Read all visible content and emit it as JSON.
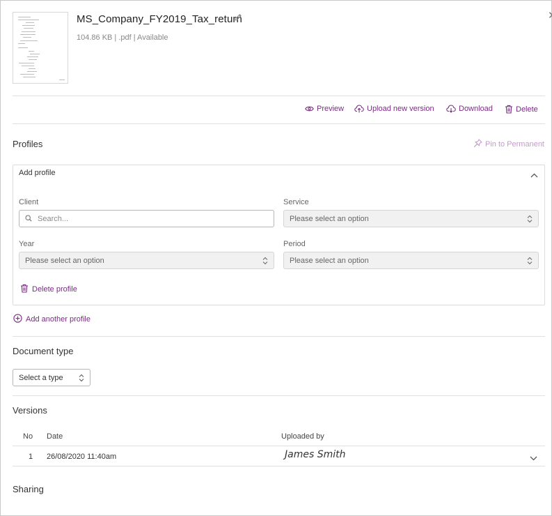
{
  "file": {
    "name": "MS_Company_FY2019_Tax_return",
    "size": "104.86 KB",
    "extension": ".pdf",
    "status": "Available",
    "meta_line": "104.86 KB | .pdf | Available"
  },
  "actions": {
    "preview": "Preview",
    "upload_new_version": "Upload new version",
    "download": "Download",
    "delete": "Delete"
  },
  "profiles": {
    "title": "Profiles",
    "pin_label": "Pin to Permanent",
    "card": {
      "title": "Add profile",
      "client_label": "Client",
      "client_placeholder": "Search...",
      "service_label": "Service",
      "service_value": "Please select an option",
      "year_label": "Year",
      "year_value": "Please select an option",
      "period_label": "Period",
      "period_value": "Please select an option",
      "delete_label": "Delete profile"
    },
    "add_another_label": "Add another profile"
  },
  "document_type": {
    "title": "Document type",
    "value": "Select a type"
  },
  "versions": {
    "title": "Versions",
    "columns": {
      "no": "No",
      "date": "Date",
      "uploaded_by": "Uploaded by"
    },
    "rows": [
      {
        "no": "1",
        "date": "26/08/2020 11:40am",
        "uploaded_by": "James Smith"
      }
    ]
  },
  "sharing": {
    "title": "Sharing"
  },
  "colors": {
    "accent": "#7b2a84",
    "accent_light": "#c49acb",
    "divider": "#e0e0e0",
    "select_bg": "#f1f1f1"
  },
  "icons": {
    "close": "close-icon",
    "edit": "pencil-icon",
    "preview": "eye-icon",
    "upload": "cloud-upload-icon",
    "download": "cloud-download-icon",
    "delete": "trash-icon",
    "pin": "pin-icon",
    "collapse": "chevron-up-icon",
    "search": "search-icon",
    "select": "updown-arrows-icon",
    "add": "plus-circle-icon",
    "expand": "chevron-down-icon"
  }
}
